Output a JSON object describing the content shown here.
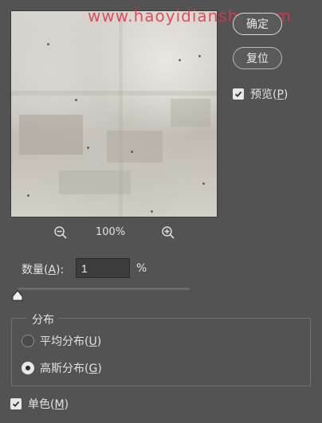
{
  "watermark": "www.haoyidianshe.com",
  "buttons": {
    "ok": "确定",
    "reset": "复位"
  },
  "preview_toggle": {
    "label": "预览",
    "key": "P",
    "checked": true
  },
  "zoom": {
    "percent": "100%",
    "zoom_out_icon": "zoom-out-icon",
    "zoom_in_icon": "zoom-in-icon"
  },
  "amount": {
    "label": "数量",
    "key": "A",
    "value": "1",
    "unit": "%",
    "slider_fraction": 0.01
  },
  "distribution": {
    "title": "分布",
    "options": [
      {
        "label": "平均分布",
        "key": "U",
        "selected": false
      },
      {
        "label": "高斯分布",
        "key": "G",
        "selected": true
      }
    ]
  },
  "monochrome": {
    "label": "单色",
    "key": "M",
    "checked": true
  },
  "colors": {
    "background": "#535353",
    "watermark": "#e2374a"
  }
}
